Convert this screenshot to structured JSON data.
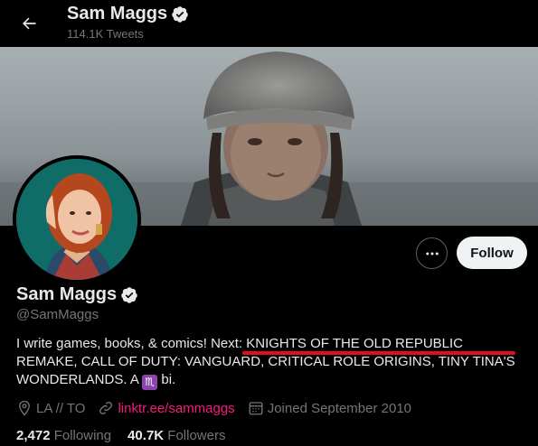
{
  "header": {
    "name": "Sam Maggs",
    "tweet_count": "114.1K Tweets"
  },
  "profile": {
    "name": "Sam Maggs",
    "handle": "@SamMaggs",
    "follow_label": "Follow",
    "more_label": "•••",
    "bio_part1": "I write games, books, & comics! Next: ",
    "bio_highlight": "KNIGHTS OF THE OLD REPUBLIC REMAKE",
    "bio_part2": ", CALL OF DUTY: VANGUARD, CRITICAL ROLE ORIGINS, TINY TINA'S WONDERLANDS. A ",
    "bio_zodiac": "♏",
    "bio_part3": " bi.",
    "location": "LA // TO",
    "website": "linktr.ee/sammaggs",
    "joined": "Joined September 2010",
    "following_count": "2,472",
    "following_label": "Following",
    "followers_count": "40.7K",
    "followers_label": "Followers"
  },
  "colors": {
    "link": "#f91880",
    "verified": "#e7e9ea",
    "underline": "#e0101b"
  }
}
